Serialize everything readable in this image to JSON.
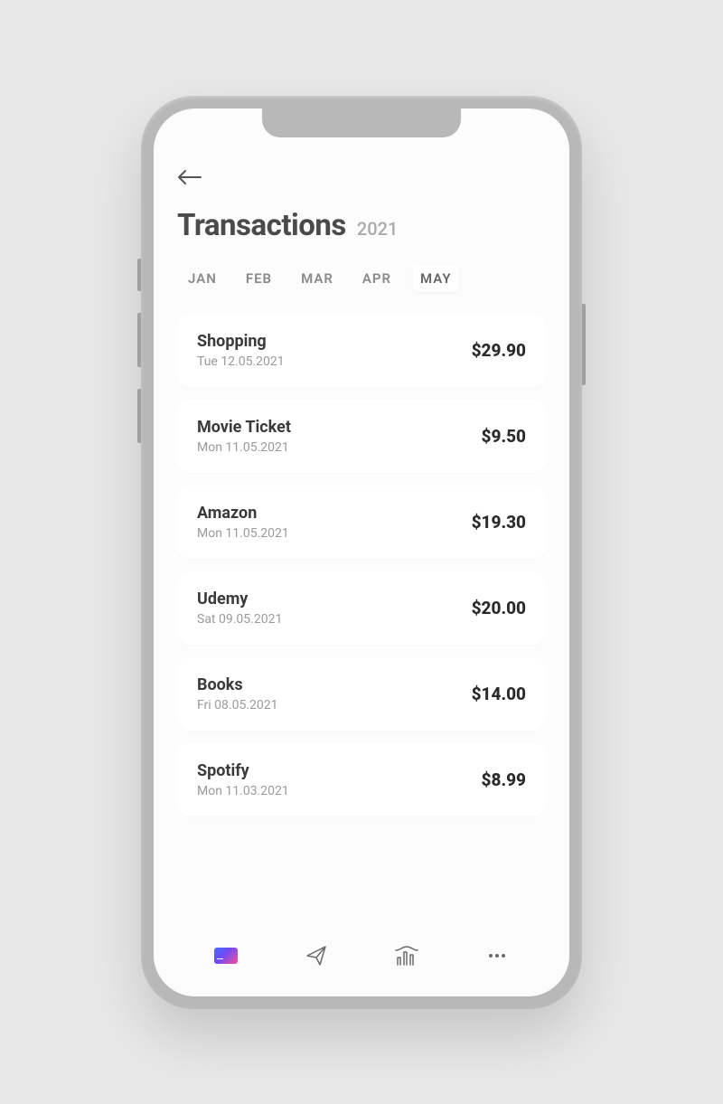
{
  "header": {
    "title": "Transactions",
    "year": "2021"
  },
  "months": [
    {
      "label": "JAN",
      "active": false
    },
    {
      "label": "FEB",
      "active": false
    },
    {
      "label": "MAR",
      "active": false
    },
    {
      "label": "APR",
      "active": false
    },
    {
      "label": "MAY",
      "active": true
    }
  ],
  "transactions": [
    {
      "name": "Shopping",
      "date": "Tue 12.05.2021",
      "amount": "$29.90"
    },
    {
      "name": "Movie Ticket",
      "date": "Mon 11.05.2021",
      "amount": "$9.50"
    },
    {
      "name": "Amazon",
      "date": "Mon 11.05.2021",
      "amount": "$19.30"
    },
    {
      "name": "Udemy",
      "date": "Sat 09.05.2021",
      "amount": "$20.00"
    },
    {
      "name": "Books",
      "date": "Fri 08.05.2021",
      "amount": "$14.00"
    },
    {
      "name": "Spotify",
      "date": "Mon 11.03.2021",
      "amount": "$8.99"
    }
  ],
  "nav": {
    "items": [
      "card",
      "send",
      "stats",
      "more"
    ]
  }
}
